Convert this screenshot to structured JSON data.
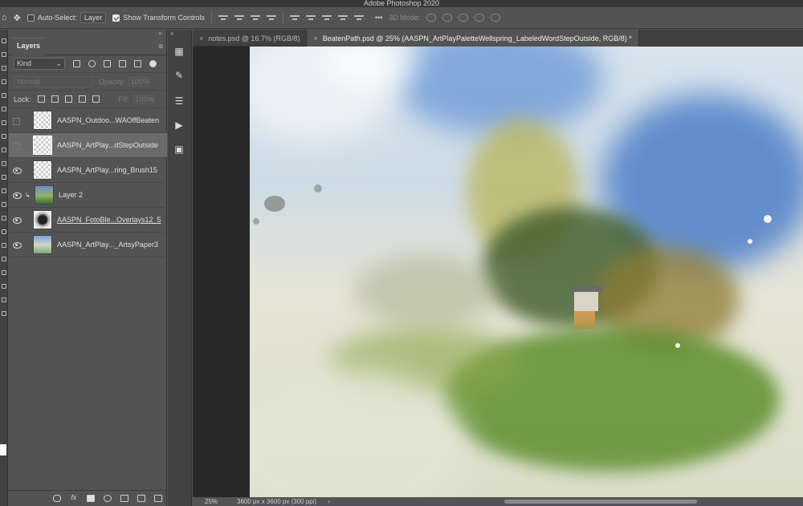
{
  "window": {
    "title": "Adobe Photoshop 2020"
  },
  "options_bar": {
    "auto_select_label": "Auto-Select:",
    "auto_select_target": "Layer",
    "show_transform_label": "Show Transform Controls",
    "more_label": "•••",
    "mode_3d_label": "3D Mode:"
  },
  "layers_panel": {
    "collapse_glyph": "»",
    "tab_label": "Layers",
    "menu_glyph": "≡",
    "filter_kind": "Kind",
    "blend_mode": "Normal",
    "opacity_label": "Opacity:",
    "opacity_value": "100%",
    "lock_label": "Lock:",
    "fill_label": "Fill:",
    "fill_value": "100%",
    "layers": [
      {
        "name": "AASPN_Outdoo...WAOffBeaten",
        "visible": false
      },
      {
        "name": "AASPN_ArtPlay...dStepOutside",
        "visible": false,
        "selected": true
      },
      {
        "name": "AASPN_ArtPlay...ring_Brush15",
        "visible": true
      },
      {
        "name": "Layer 2",
        "visible": true,
        "clipped": true
      },
      {
        "name": "AASPN_FotoBle...Overlays12_5",
        "visible": true
      },
      {
        "name": "AASPN_ArtPlay..._ArtsyPaper3",
        "visible": true
      }
    ],
    "footer_fx": "fx"
  },
  "side_dock": {
    "collapse_glyph": "»"
  },
  "document_tabs": [
    {
      "label": "notes.psd @ 16.7% (RGB/8)",
      "active": false
    },
    {
      "label": "BeatenPath.psd @ 25% (AASPN_ArtPlayPaletteWellspring_LabeledWordStepOutside, RGB/8) *",
      "active": true
    }
  ],
  "status_bar": {
    "zoom": "25%",
    "doc_size": "3600 px x 3600 px (300 ppi)",
    "arrow": "›"
  },
  "colors": {
    "panel_bg": "#535353",
    "canvas_bg": "#282828",
    "foreground_swatch": "#ffffff"
  }
}
